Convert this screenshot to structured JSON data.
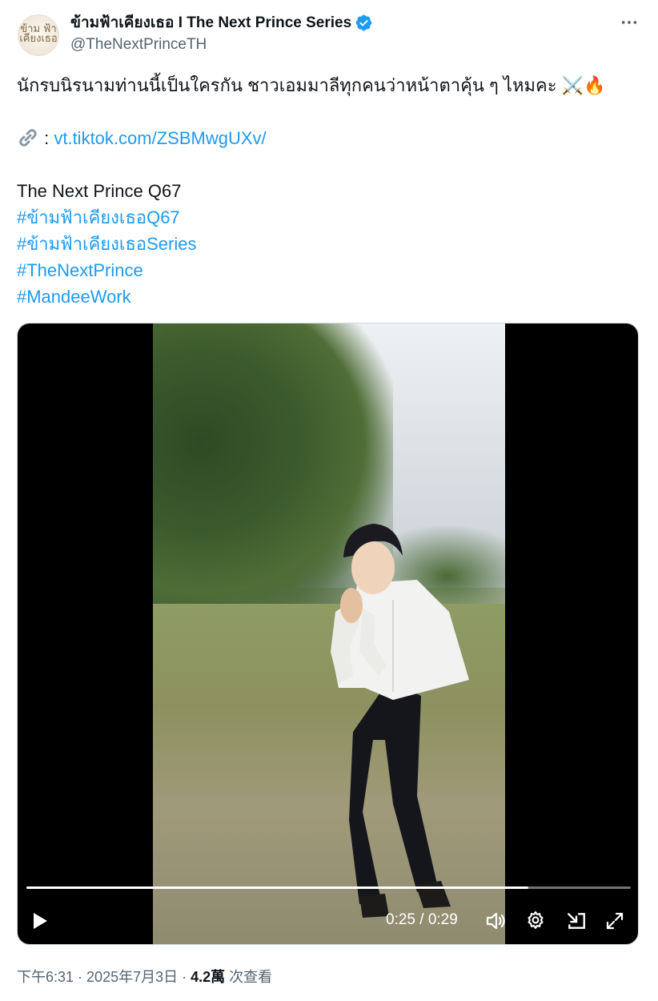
{
  "account": {
    "display_name": "ข้ามฟ้าเคียงเธอ I The Next Prince Series",
    "handle": "@TheNextPrinceTH",
    "avatar_text": "ข้ามฟ้าเคียงเธอ",
    "verified": true,
    "icons": {
      "verified": "verified-badge-icon",
      "more": "more-options-icon"
    }
  },
  "tweet": {
    "text_line1": "นักรบนิรนามท่านนี้เป็นใครกัน ชาวเอมมาลีทุกคนว่าหน้าตาคุ้น ๆ ไหมคะ ",
    "emoji1": "⚔️",
    "emoji2": "🔥",
    "link_prefix": " : ",
    "link_text": "vt.tiktok.com/ZSBMwgUXv/",
    "title_line": "The Next Prince Q67",
    "hashtags": [
      "#ข้ามฟ้าเคียงเธอQ67",
      "#ข้ามฟ้าเคียงเธอSeries",
      "#TheNextPrince",
      "#MandeeWork"
    ],
    "colors": {
      "link": "#1d9bf0",
      "text": "#0f1419",
      "secondary": "#536471"
    }
  },
  "video": {
    "current_time": "0:25",
    "separator": " / ",
    "duration": "0:29",
    "progress": 0.83,
    "icons": [
      "play-icon",
      "volume-icon",
      "settings-gear-icon",
      "picture-in-picture-icon",
      "fullscreen-icon"
    ]
  },
  "meta": {
    "time": "下午6:31",
    "dot1": " · ",
    "date": "2025年7月3日",
    "dot2": " · ",
    "views_count": "4.2萬",
    "views_label": " 次查看"
  }
}
